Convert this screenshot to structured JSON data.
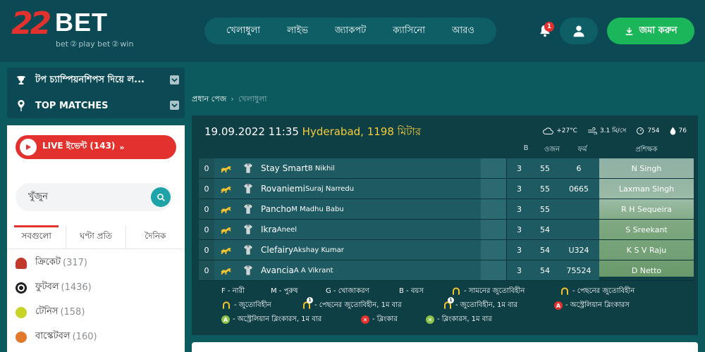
{
  "brand": {
    "logo_mark": "22",
    "logo_text": "BET",
    "tagline": "bet ② play   bet ② win"
  },
  "nav": {
    "items": [
      "খেলাধুলা",
      "লাইভ",
      "জ্যাকপট",
      "ক্যাসিনো",
      "আরও"
    ]
  },
  "header": {
    "notification_count": "1",
    "deposit_label": "জমা করুন"
  },
  "sidebar": {
    "top_champs_label": "টপ চ্যাম্পিয়নশিপস দিয়ে ল...",
    "top_matches_label": "TOP MATCHES",
    "live_events_label": "LIVE ইভেন্ট (143)",
    "search_placeholder": "খুঁজুন",
    "tabs": [
      "সবগুলো",
      "ঘণ্টা প্রতি",
      "দৈনিক"
    ],
    "sports": [
      {
        "name": "ক্রিকেট",
        "count": "(317)",
        "color": "#c0392b"
      },
      {
        "name": "ফুটবল",
        "count": "(1436)",
        "color": "#222222"
      },
      {
        "name": "টেনিস",
        "count": "(158)",
        "color": "#c7d326"
      },
      {
        "name": "বাস্কেটবল",
        "count": "(160)",
        "color": "#e07a2a"
      }
    ]
  },
  "breadcrumb": {
    "home": "প্রধান পেজ",
    "current": "খেলাধুলা"
  },
  "race": {
    "datetime": "19.09.2022 11:35",
    "venue": "Hyderabad, 1198 মিটার",
    "weather": {
      "temp": "+27°C",
      "wind": "3.1 মি/সে",
      "pressure": "754",
      "humidity": "76"
    },
    "columns": {
      "b": "B",
      "weight": "ওজন",
      "form": "ফর্ম",
      "trainer": "প্রশিক্ষক"
    },
    "runners": [
      {
        "num": "0",
        "horse": "Stay Smart",
        "jockey": "B Nikhil",
        "b": "3",
        "weight": "55",
        "form": "6",
        "trainer": "N Singh"
      },
      {
        "num": "0",
        "horse": "Rovaniemi",
        "jockey": "Suraj Narredu",
        "b": "3",
        "weight": "55",
        "form": "0665",
        "trainer": "Laxman Singh"
      },
      {
        "num": "0",
        "horse": "Pancho",
        "jockey": "M Madhu Babu",
        "b": "3",
        "weight": "55",
        "form": "",
        "trainer": "R H Sequeira"
      },
      {
        "num": "0",
        "horse": "Ikra",
        "jockey": "Aneel",
        "b": "3",
        "weight": "54",
        "form": "",
        "trainer": "S Sreekant"
      },
      {
        "num": "0",
        "horse": "Clefairy",
        "jockey": "Akshay Kumar",
        "b": "3",
        "weight": "54",
        "form": "U324",
        "trainer": "K S V Raju"
      },
      {
        "num": "0",
        "horse": "Avancia",
        "jockey": "A A Vikrant",
        "b": "3",
        "weight": "54",
        "form": "75524",
        "trainer": "D Netto"
      }
    ],
    "legend": {
      "f": "F - নারী",
      "m": "M - পুরুষ",
      "g": "G - খোজাকরণ",
      "b": "B - বয়স",
      "front_unshod": "- সামনের জুতোবিহীন",
      "rear_unshod": "- পেছনের জুতোবিহীন",
      "unshod": "- জুতোবিহীন",
      "rear_unshod_first": "- পেছনের জুতোবিহীন, 1ম বার",
      "unshod_first": "- জুতোবিহীন, 1ম বার",
      "aus_blinkers": "- অস্ট্রেলিয়ান ব্লিংকারস",
      "aus_blinkers_first": "- অস্ট্রেলিয়ান ব্লিংকারস, 1ম বার",
      "blinkers": "- ব্লিংকার",
      "blinkers_first": "- ব্লিংকারস, 1ম বার",
      "badge_a": "A",
      "badge_first": "1"
    }
  }
}
